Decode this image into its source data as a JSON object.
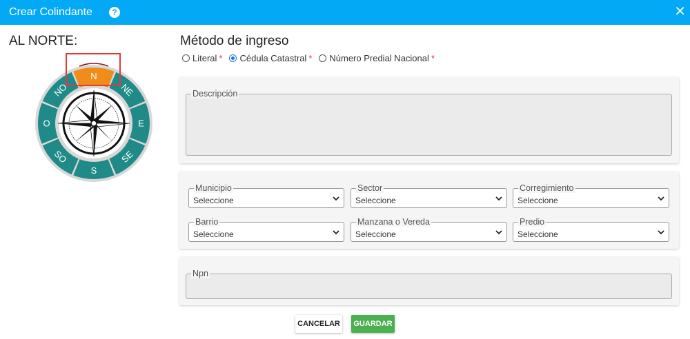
{
  "window": {
    "title": "Crear Colindante",
    "help_icon": "help-icon",
    "close_icon": "close-icon"
  },
  "compass": {
    "heading": "AL NORTE:",
    "selected": "N",
    "directions": [
      "N",
      "NE",
      "E",
      "SE",
      "S",
      "SO",
      "O",
      "NO"
    ],
    "colors": {
      "ring": "#1f8a87",
      "selected": "#ef8c1a",
      "highlight_box": "#e53935"
    }
  },
  "method": {
    "title": "Método de ingreso",
    "options": [
      {
        "label": "Literal",
        "required": "*",
        "checked": false
      },
      {
        "label": "Cédula Catastral",
        "required": "*",
        "checked": true
      },
      {
        "label": "Número Predial Nacional",
        "required": "*",
        "checked": false
      }
    ]
  },
  "description": {
    "label": "Descripción",
    "value": ""
  },
  "location": {
    "municipio": {
      "label": "Municipio",
      "value": "Seleccione"
    },
    "sector": {
      "label": "Sector",
      "value": "Seleccione"
    },
    "corregimiento": {
      "label": "Corregimiento",
      "value": "Seleccione"
    },
    "barrio": {
      "label": "Barrio",
      "value": "Seleccione"
    },
    "manzana": {
      "label": "Manzana o Vereda",
      "value": "Seleccione"
    },
    "predio": {
      "label": "Predio",
      "value": "Seleccione"
    }
  },
  "npn": {
    "label": "Npn",
    "value": ""
  },
  "actions": {
    "cancel": "CANCELAR",
    "save": "GUARDAR"
  }
}
